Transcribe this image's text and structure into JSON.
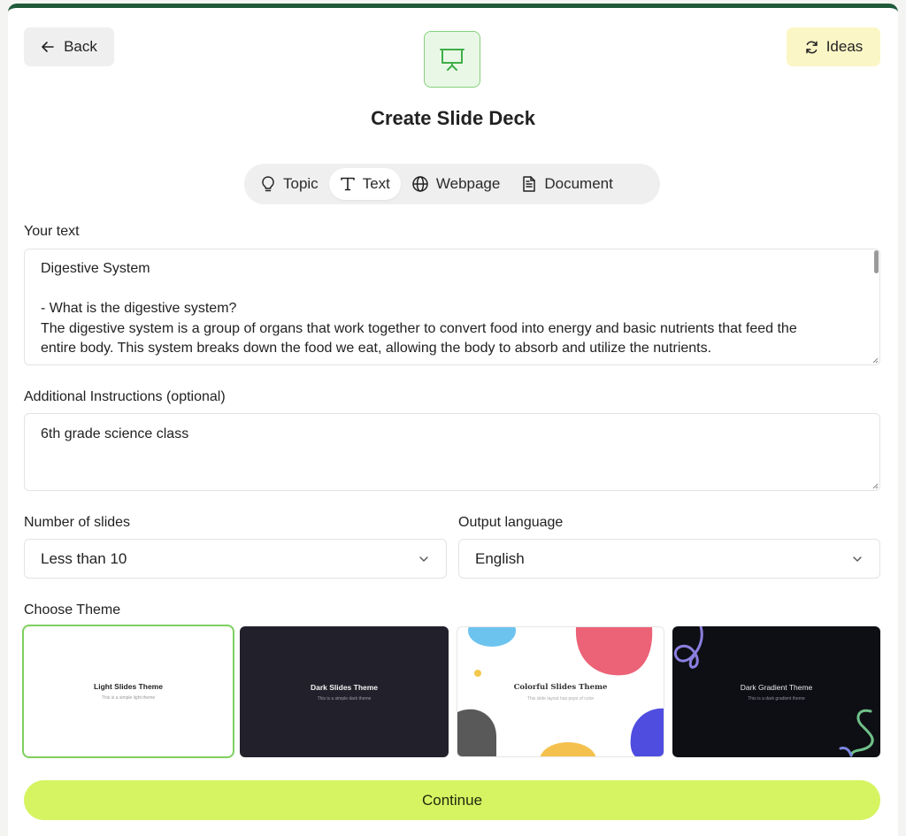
{
  "header": {
    "back_label": "Back",
    "ideas_label": "Ideas",
    "title": "Create Slide Deck"
  },
  "tabs": [
    {
      "label": "Topic",
      "icon": "lightbulb-icon",
      "active": false
    },
    {
      "label": "Text",
      "icon": "text-icon",
      "active": true
    },
    {
      "label": "Webpage",
      "icon": "globe-icon",
      "active": false
    },
    {
      "label": "Document",
      "icon": "document-icon",
      "active": false
    }
  ],
  "your_text": {
    "label": "Your text",
    "lines": [
      "Digestive System",
      "",
      "- What is the digestive system?",
      "The digestive system is a group of organs that work together to convert food into energy and basic nutrients that feed the",
      "entire body. This system breaks down the food we eat, allowing the body to absorb and utilize the nutrients."
    ]
  },
  "instructions": {
    "label": "Additional Instructions (optional)",
    "value": "6th grade science class"
  },
  "slides": {
    "label": "Number of slides",
    "value": "Less than 10"
  },
  "language": {
    "label": "Output language",
    "value": "English"
  },
  "themes": {
    "label": "Choose Theme",
    "items": [
      {
        "title": "Light Slides Theme",
        "subtitle": "This is a simple light theme",
        "selected": true
      },
      {
        "title": "Dark Slides Theme",
        "subtitle": "This is a simple dark theme",
        "selected": false
      },
      {
        "title": "Colorful Slides Theme",
        "subtitle": "This slide layout has pops of color",
        "selected": false
      },
      {
        "title": "Dark Gradient Theme",
        "subtitle": "This is a dark gradient theme",
        "selected": false
      }
    ]
  },
  "continue_label": "Continue",
  "colors": {
    "accent_green": "#1f5a3a",
    "continue_bg": "#d6f461",
    "ideas_bg": "#fbf6c6",
    "selected_border": "#7ed05f"
  }
}
